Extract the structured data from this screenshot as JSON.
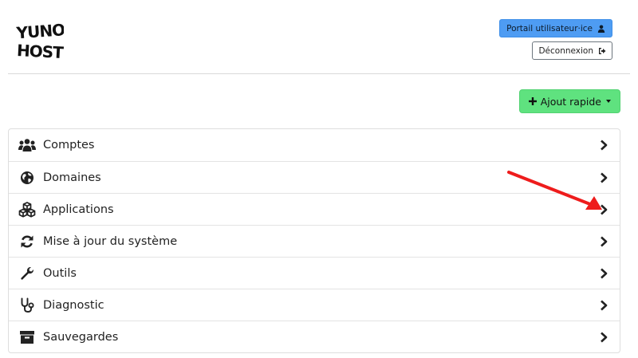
{
  "logo": {
    "text": "YUNOHOST",
    "line1": "YUNO",
    "line2": "HOST"
  },
  "header": {
    "portal_button": {
      "label": "Portail utilisateur·ice",
      "icon": "user-icon"
    },
    "logout_button": {
      "label": "Déconnexion",
      "icon": "sign-out-icon"
    }
  },
  "quick_add": {
    "label": "Ajout rapide",
    "icon": "plus-icon",
    "color": "#5fe27f"
  },
  "menu": {
    "items": [
      {
        "label": "Comptes",
        "icon": "users-icon"
      },
      {
        "label": "Domaines",
        "icon": "globe-icon"
      },
      {
        "label": "Applications",
        "icon": "cubes-icon"
      },
      {
        "label": "Mise à jour du système",
        "icon": "refresh-icon"
      },
      {
        "label": "Outils",
        "icon": "wrench-icon"
      },
      {
        "label": "Diagnostic",
        "icon": "stethoscope-icon"
      },
      {
        "label": "Sauvegardes",
        "icon": "archive-icon"
      }
    ]
  },
  "annotation": {
    "type": "red-arrow",
    "points_to": "Applications",
    "color": "#ee1c1c"
  },
  "colors": {
    "portal_blue": "#4e9cf3",
    "quick_green": "#5fe27f",
    "border": "#dedede"
  }
}
